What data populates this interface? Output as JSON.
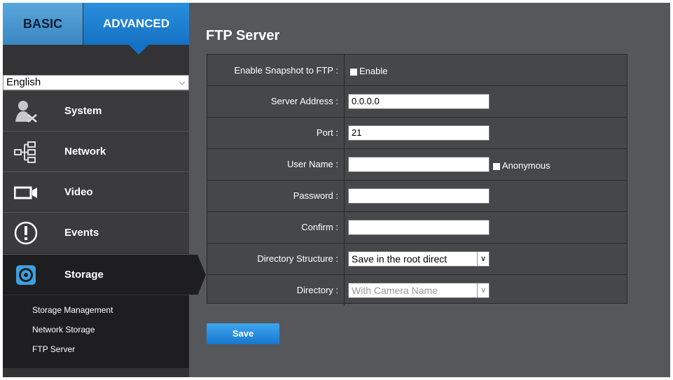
{
  "tabs": {
    "basic": "BASIC",
    "advanced": "ADVANCED"
  },
  "language": {
    "selected": "English"
  },
  "sidebar": {
    "items": [
      {
        "label": "System",
        "icon": "system-tools-icon"
      },
      {
        "label": "Network",
        "icon": "network-tree-icon"
      },
      {
        "label": "Video",
        "icon": "video-camera-icon"
      },
      {
        "label": "Events",
        "icon": "alert-icon"
      },
      {
        "label": "Storage",
        "icon": "storage-disk-icon"
      }
    ],
    "submenu": [
      "Storage Management",
      "Network Storage",
      "FTP Server"
    ]
  },
  "page": {
    "title": "FTP Server"
  },
  "form": {
    "enable_snapshot_label": "Enable Snapshot to FTP :",
    "enable_option": "Enable",
    "server_address_label": "Server Address :",
    "server_address_value": "0.0.0.0",
    "port_label": "Port :",
    "port_value": "21",
    "user_name_label": "User Name :",
    "user_name_value": "",
    "anonymous_option": "Anonymous",
    "password_label": "Password :",
    "confirm_label": "Confirm :",
    "directory_structure_label": "Directory Structure :",
    "directory_structure_value": "Save in the root direct",
    "directory_label": "Directory :",
    "directory_value": "With Camera Name"
  },
  "buttons": {
    "save": "Save"
  },
  "colors": {
    "accent": "#1678cf",
    "panel": "#46474a",
    "sidebar": "#333335"
  }
}
